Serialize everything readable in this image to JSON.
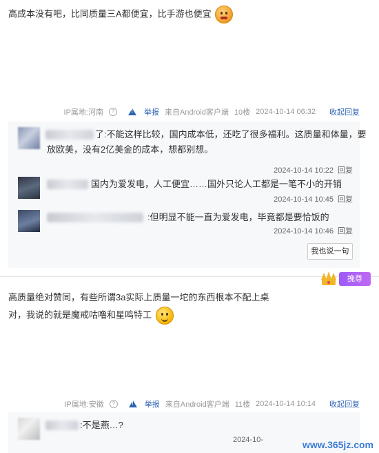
{
  "post1": {
    "text": "高成本没有吧，比同质量三A都便宜，比手游也便宜",
    "meta": {
      "ip_label": "IP属地:河南",
      "report": "举报",
      "source": "来自Android客户端",
      "floor": "10楼",
      "time": "2024-10-14 06:32",
      "collapse": "收起回复"
    },
    "replies": [
      {
        "name_suffix": "了",
        "text_line1": ":不能这样比较，国内成本低，还吃了很多福利。这质量和体量，要",
        "text_line2": "放欧美，没有2亿美金的成本，想都别想。",
        "time": "2024-10-14 10:22",
        "reply": "回复"
      },
      {
        "name_suffix": "",
        "text_line1": "国内为爱发电，人工便宜……国外只论人工都是一笔不小的开销",
        "time": "2024-10-14 10:45",
        "reply": "回复"
      },
      {
        "name_suffix": "",
        "text_line1": ":但明显不能一直为爱发电，毕竟都是要恰饭的",
        "time": "2024-10-14 10:46",
        "reply": "回复"
      }
    ],
    "say_button": "我也说一句"
  },
  "badge": {
    "label": "挽尊"
  },
  "post2": {
    "line1": "高质量绝对赞同，有些所谓3a实际上质量一坨的东西根本不配上桌",
    "line2": "对，我说的就是魔戒咕噜和星鸣特工",
    "meta": {
      "ip_label": "IP属地:安徽",
      "report": "举报",
      "source": "来自Android客户端",
      "floor": "11楼",
      "time": "2024-10-14 10:14",
      "collapse": "收起回复"
    },
    "replies": [
      {
        "text_line1": ":不是燕…?",
        "time": "2024-10-",
        "reply": ""
      }
    ]
  },
  "watermark": "www.365jz.com",
  "colors": {
    "link": "#2d64b3",
    "reply_bg": "#f7f8fa",
    "badge": "#b064f4"
  }
}
